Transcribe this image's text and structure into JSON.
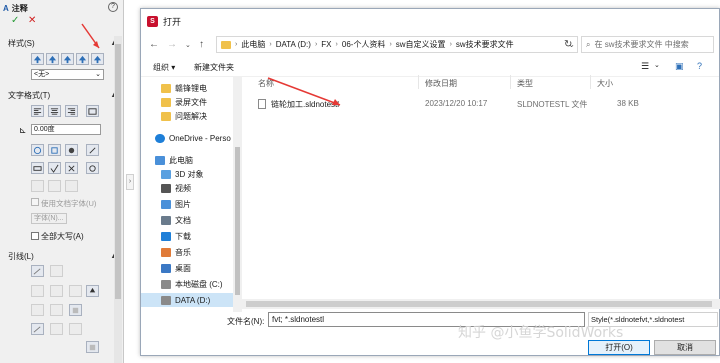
{
  "property_manager": {
    "title": "注释",
    "ok": "✓",
    "cancel": "✕",
    "help": "?",
    "sections": {
      "style": "样式(S)",
      "style_select": "<无>",
      "text_format": "文字格式(T)",
      "angle_value": "0.00度",
      "use_doc_font": "使用文档字体(U)",
      "font_button": "字体(N)...",
      "all_caps": "全部大写(A)",
      "leader": "引线(L)"
    }
  },
  "dialog": {
    "title": "打开",
    "breadcrumbs": [
      "此电脑",
      "DATA (D:)",
      "FX",
      "06-个人资料",
      "sw自定义设置",
      "sw技术要求文件"
    ],
    "search_placeholder": "在 sw技术要求文件 中搜索",
    "commands": {
      "organize": "组织 ▾",
      "new_folder": "新建文件夹"
    },
    "nav_items": [
      {
        "label": "赣锋锂电",
        "icon": "folder-icon",
        "selected": false
      },
      {
        "label": "录屏文件",
        "icon": "folder-icon",
        "selected": false
      },
      {
        "label": "问题解决",
        "icon": "folder-icon",
        "selected": false
      },
      {
        "label": "OneDrive - Perso",
        "icon": "cloud-icon",
        "selected": false
      },
      {
        "label": "此电脑",
        "icon": "computer-icon",
        "selected": false
      },
      {
        "label": "3D 对象",
        "icon": "3d-objects-icon",
        "selected": false
      },
      {
        "label": "视频",
        "icon": "video-icon",
        "selected": false
      },
      {
        "label": "图片",
        "icon": "picture-icon",
        "selected": false
      },
      {
        "label": "文档",
        "icon": "document-icon",
        "selected": false
      },
      {
        "label": "下载",
        "icon": "download-icon",
        "selected": false
      },
      {
        "label": "音乐",
        "icon": "music-icon",
        "selected": false
      },
      {
        "label": "桌面",
        "icon": "desktop-icon",
        "selected": false
      },
      {
        "label": "本地磁盘 (C:)",
        "icon": "drive-icon",
        "selected": false
      },
      {
        "label": "DATA (D:)",
        "icon": "drive-icon",
        "selected": true
      }
    ],
    "columns": [
      "名称",
      "修改日期",
      "类型",
      "大小"
    ],
    "files": [
      {
        "name": "链轮加工.sldnotestl",
        "modified": "2023/12/20 10:17",
        "type": "SLDNOTESTL 文件",
        "size": "38 KB"
      }
    ],
    "filename_label": "文件名(N):",
    "filename_value": "fvt; *.sldnotestl",
    "filetype_value": "Style(*.sldnotefvt,*.sldnotest",
    "open_button": "打开(O)",
    "cancel_button": "取消"
  },
  "watermark": "知乎 @小鱼学SolidWorks",
  "colors": {
    "accent": "#0078d7",
    "arrow": "#e53935",
    "folder": "#f0c14b",
    "selection": "#cce4f7"
  }
}
